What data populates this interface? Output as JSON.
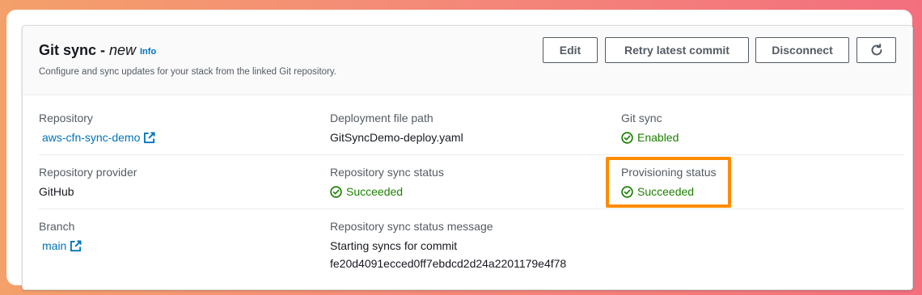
{
  "header": {
    "title": "Git sync",
    "separator": " - ",
    "subtitle": "new",
    "info_label": "Info",
    "description": "Configure and sync updates for your stack from the linked Git repository.",
    "buttons": {
      "edit": "Edit",
      "retry": "Retry latest commit",
      "disconnect": "Disconnect",
      "refresh_icon": "refresh-icon"
    }
  },
  "fields": {
    "repository": {
      "label": "Repository",
      "value": "aws-cfn-sync-demo",
      "icon": "external-link-icon"
    },
    "deployment_file_path": {
      "label": "Deployment file path",
      "value": "GitSyncDemo-deploy.yaml"
    },
    "git_sync": {
      "label": "Git sync",
      "value": "Enabled",
      "icon": "success-check-icon"
    },
    "repository_provider": {
      "label": "Repository provider",
      "value": "GitHub"
    },
    "repository_sync_status": {
      "label": "Repository sync status",
      "value": "Succeeded",
      "icon": "success-check-icon"
    },
    "provisioning_status": {
      "label": "Provisioning status",
      "value": "Succeeded",
      "icon": "success-check-icon",
      "highlight_color": "#ff8c00"
    },
    "branch": {
      "label": "Branch",
      "value": "main",
      "icon": "external-link-icon"
    },
    "repository_sync_status_message": {
      "label": "Repository sync status message",
      "line1": "Starting syncs for commit",
      "line2": "fe20d4091ecced0ff7ebdcd2d24a2201179e4f78"
    }
  },
  "colors": {
    "link": "#0073bb",
    "success": "#1d8102",
    "label": "#545b64",
    "text": "#16191f",
    "highlight": "#ff8c00"
  }
}
